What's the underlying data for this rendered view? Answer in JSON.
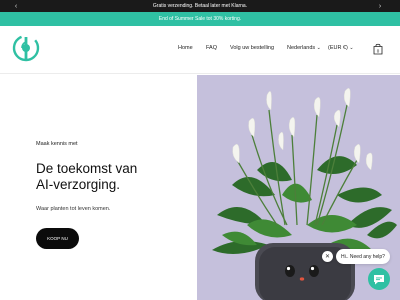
{
  "announcement": {
    "text": "Gratis verzending. Betaal later met Klarna.",
    "prev_icon": "chevron-left-icon",
    "next_icon": "chevron-right-icon"
  },
  "promo": {
    "text": "End of Summer Sale tot 30% korting."
  },
  "header": {
    "logo_icon": "brand-logo-icon",
    "nav": {
      "home": "Home",
      "faq": "FAQ",
      "track": "Volg uw bestelling",
      "language": "Nederlands",
      "currency": "(EUR €)"
    },
    "cart_icon": "shopping-bag-icon",
    "cart_count": "0"
  },
  "hero": {
    "eyebrow": "Maak kennis met",
    "headline_line1": "De toekomst van",
    "headline_line2": "AI-verzorging.",
    "subtext": "Waar planten tot leven komen.",
    "cta": "KOOP NU"
  },
  "chat": {
    "greeting": "Hi.. Need any help?",
    "close_icon": "close-icon",
    "chat_icon": "chat-icon"
  },
  "colors": {
    "accent": "#2fc0a3",
    "topbar": "#1a1a1a",
    "hero_bg": "#c5c0dc"
  }
}
